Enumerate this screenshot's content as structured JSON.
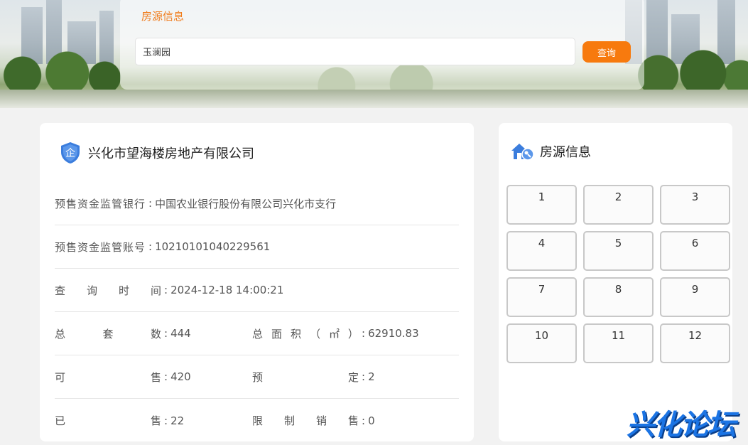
{
  "search": {
    "title": "房源信息",
    "value": "玉澜园",
    "button_label": "查询"
  },
  "company": {
    "icon_text": "企",
    "name": "兴化市望海楼房地产有限公司",
    "bank_label": "预售资金监管银行",
    "bank_value": "中国农业银行股份有限公司兴化市支行",
    "account_label": "预售资金监管账号",
    "account_value": "10210101040229561",
    "time_label": [
      "查",
      "询",
      "时",
      "间"
    ],
    "time_value": "2024-12-18 14:00:21",
    "total_label": [
      "总",
      "套",
      "数"
    ],
    "total_value": "444",
    "area_label": [
      "总",
      "面",
      "积",
      "（",
      "㎡",
      "）"
    ],
    "area_value": "62910.83",
    "sellable_label": [
      "可",
      "售"
    ],
    "sellable_value": "420",
    "reserved_label": [
      "预",
      "定"
    ],
    "reserved_value": "2",
    "sold_label": [
      "已",
      "售"
    ],
    "sold_value": "22",
    "restricted_label": [
      "限",
      "制",
      "销",
      "售"
    ],
    "restricted_value": "0"
  },
  "houses": {
    "title": "房源信息",
    "units": [
      "1",
      "2",
      "3",
      "4",
      "5",
      "6",
      "7",
      "8",
      "9",
      "10",
      "11",
      "12"
    ]
  },
  "watermark": "兴化论坛",
  "colors": {
    "accent": "#f77a0e",
    "title_orange": "#f07c1c",
    "shield_blue": "#3b7ddd"
  }
}
